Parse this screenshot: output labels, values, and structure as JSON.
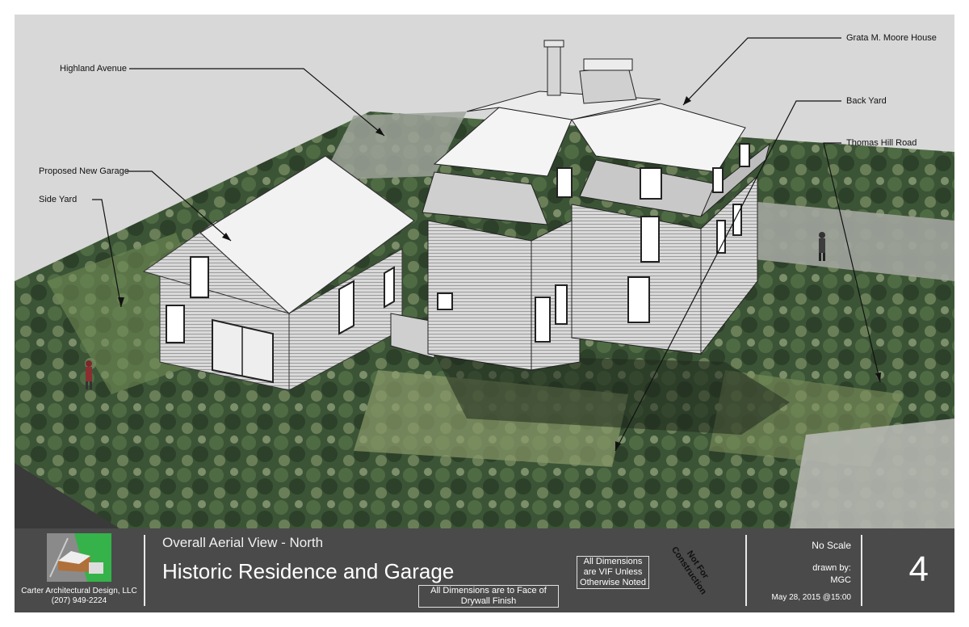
{
  "callouts": {
    "highland_avenue": "Highland Avenue",
    "proposed_garage": "Proposed New Garage",
    "side_yard": "Side Yard",
    "moore_house": "Grata M. Moore House",
    "back_yard": "Back Yard",
    "thomas_hill_road": "Thomas Hill Road"
  },
  "titleblock": {
    "firm_name": "Carter Architectural Design, LLC",
    "firm_phone": "(207) 949-2224",
    "subtitle": "Overall Aerial View - North",
    "title": "Historic Residence and Garage",
    "note_drywall": "All Dimensions are to Face of Drywall Finish",
    "note_vif": "All Dimensions are VIF Unless Otherwise Noted",
    "not_for_construction": "Not For Construction",
    "scale": "No Scale",
    "drawn_by_label": "drawn by:",
    "drawn_by": "MGC",
    "date": "May 28, 2015 @15:00",
    "sheet_number": "4"
  },
  "colors": {
    "titlebar": "#4a4a4a",
    "sky": "#d6d6d6",
    "foliage": "#3f5a3a",
    "building": "#e9e9e9"
  }
}
